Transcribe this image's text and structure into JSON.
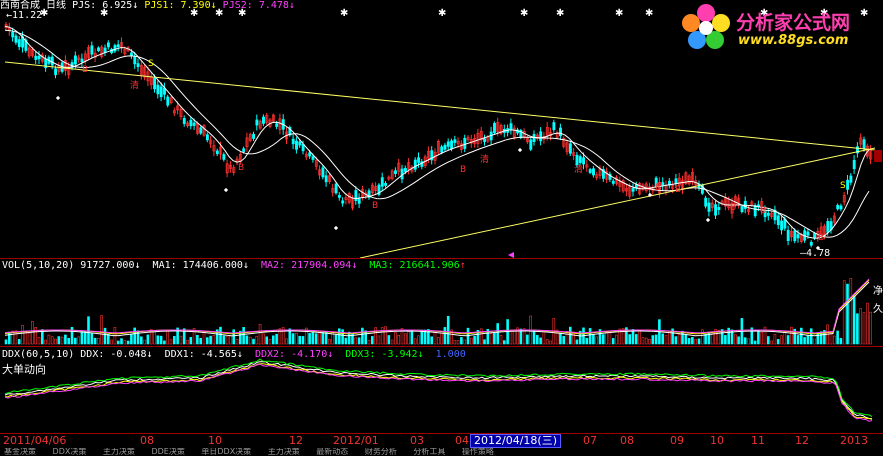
{
  "header": {
    "stock_name": "西南合成",
    "period": "日线",
    "pjs_label": "PJS:",
    "pjs_value": "6.925",
    "pjs1_label": "PJS1:",
    "pjs1_value": "7.390",
    "pjs2_label": "PJS2:",
    "pjs2_value": "7.478",
    "arrow_down": "↓",
    "arrow_up": "↑"
  },
  "price_chart": {
    "high_marker": "11.22",
    "low_marker": "4.78",
    "signal_label_qing": "清",
    "signal_label_b": "B",
    "signal_label_s": "S"
  },
  "volume_panel": {
    "title": "VOL(5,10,20)",
    "vol_value": "91727.000",
    "ma1_label": "MA1:",
    "ma1_value": "174406.000",
    "ma2_label": "MA2:",
    "ma2_value": "217904.094",
    "ma3_label": "MA3:",
    "ma3_value": "216641.906",
    "side_labels": [
      "净",
      "久"
    ]
  },
  "ddx_panel": {
    "title": "DDX(60,5,10)",
    "ddx_label": "DDX:",
    "ddx_value": "-0.048",
    "ddx1_label": "DDX1:",
    "ddx1_value": "-4.565",
    "ddx2_label": "DDX2:",
    "ddx2_value": "-4.170",
    "ddx3_label": "DDX3:",
    "ddx3_value": "-3.942",
    "extra_value": "1.000",
    "subtitle": "大单动向"
  },
  "time_axis": {
    "labels": [
      "2011/04/06",
      "08",
      "10",
      "12",
      "2012/01",
      "03",
      "04",
      "2012/04/18(三)",
      "07",
      "08",
      "09",
      "10",
      "11",
      "12",
      "2013"
    ],
    "selected": "2012/04/18(三)"
  },
  "bottom_tabs": [
    "基金决策",
    "DDX决策",
    "主力决策",
    "DDE决策",
    "单日DDX决策",
    "主力决策",
    "最新动态",
    "财务分析",
    "分析工具",
    "操作策略"
  ],
  "logo": {
    "title": "分析家公式网",
    "url": "www.88gs.com"
  },
  "colors": {
    "grid_red": "#a00000",
    "candle_up": "#ff3030",
    "candle_down": "#00ffff",
    "trend_line": "#ffff66",
    "ma_white": "#ffffff",
    "ma_yellow": "#ffff00",
    "ma_magenta": "#ff40ff",
    "ma_green": "#00ff00"
  }
}
